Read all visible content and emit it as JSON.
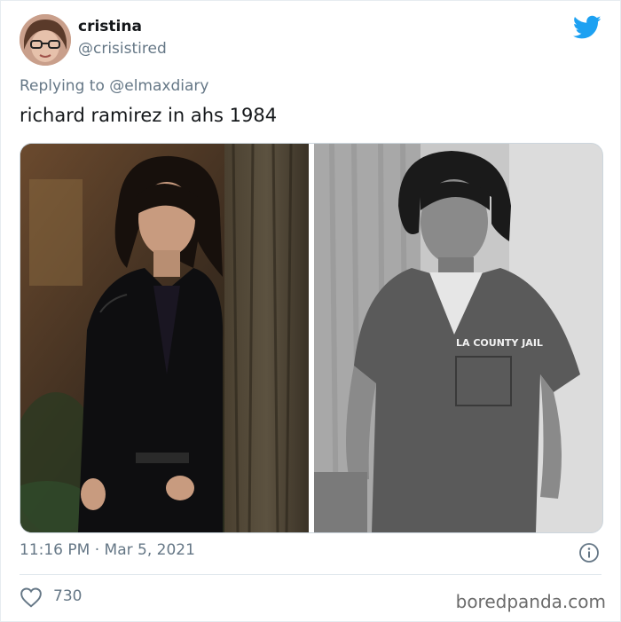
{
  "tweet": {
    "display_name": "cristina",
    "handle": "@crisistired",
    "reply_prefix": "Replying to",
    "reply_mention": "@elmaxdiary",
    "text": "richard ramirez in ahs 1984",
    "timestamp": "11:16 PM · Mar 5, 2021",
    "likes": "730"
  },
  "media": {
    "left_photo_label": "",
    "right_photo_jail_text": "LA COUNTY JAIL"
  },
  "watermark": "boredpanda.com",
  "colors": {
    "twitter_blue": "#1da1f2",
    "secondary_text": "#657786",
    "primary_text": "#14171a"
  },
  "icons": {
    "brand": "twitter-bird-icon",
    "info": "info-icon",
    "like": "heart-icon"
  }
}
